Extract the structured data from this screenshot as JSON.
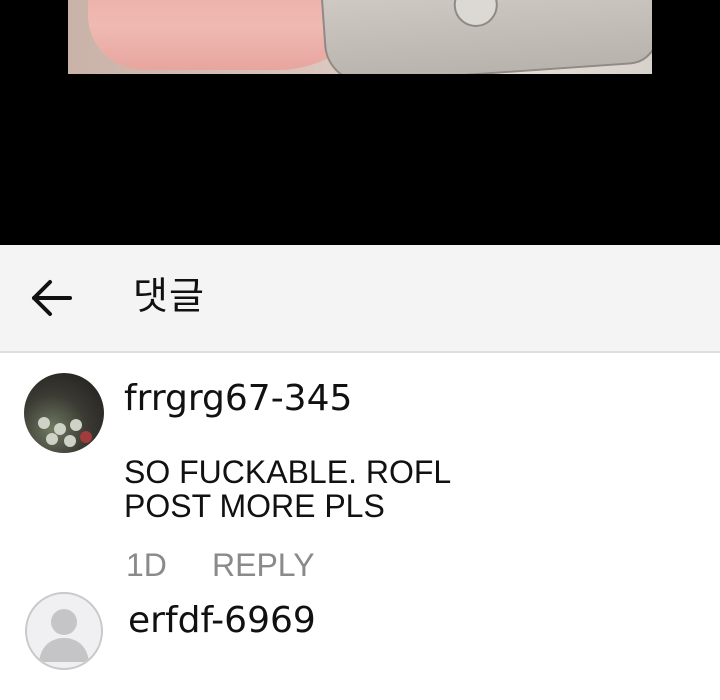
{
  "header": {
    "title": "댓글",
    "back_icon": "arrow-left-icon"
  },
  "comments": [
    {
      "username": "frrgrg67-345",
      "text": "SO FUCKABLE. ROFL\nPOST MORE PLS",
      "time": "1D",
      "reply_label": "REPLY",
      "avatar": "photo"
    },
    {
      "username": "erfdf-6969",
      "avatar": "default-user-icon"
    }
  ],
  "colors": {
    "header_bg": "#f4f4f4",
    "meta_gray": "#8a8a8a",
    "text": "#111111"
  }
}
